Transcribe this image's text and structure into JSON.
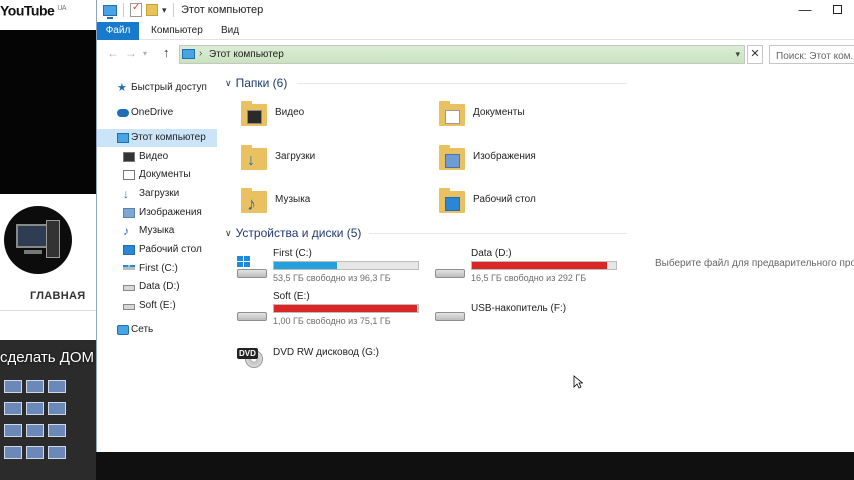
{
  "youtube": {
    "logo": "YouTube",
    "region": "UA",
    "nav_label": "ГЛАВНАЯ",
    "video_title": "сделать ДОМ"
  },
  "window": {
    "title": "Этот компьютер",
    "minimize": "—"
  },
  "ribbon": {
    "tabs": [
      "Файл",
      "Компьютер",
      "Вид"
    ],
    "active_tab": "Файл",
    "accent": "#1979ca"
  },
  "address": {
    "path": "Этот компьютер",
    "search_placeholder": "Поиск: Этот ком..."
  },
  "nav_pane": [
    {
      "label": "Быстрый доступ",
      "icon": "star-icon"
    },
    {
      "label": "OneDrive",
      "icon": "cloud-icon"
    },
    {
      "label": "Этот компьютер",
      "icon": "computer-icon",
      "selected": true
    },
    {
      "label": "Видео",
      "icon": "video-folder-icon"
    },
    {
      "label": "Документы",
      "icon": "documents-folder-icon"
    },
    {
      "label": "Загрузки",
      "icon": "downloads-folder-icon"
    },
    {
      "label": "Изображения",
      "icon": "pictures-folder-icon"
    },
    {
      "label": "Музыка",
      "icon": "music-folder-icon"
    },
    {
      "label": "Рабочий стол",
      "icon": "desktop-folder-icon"
    },
    {
      "label": "First (C:)",
      "icon": "windows-drive-icon"
    },
    {
      "label": "Data (D:)",
      "icon": "drive-icon"
    },
    {
      "label": "Soft (E:)",
      "icon": "drive-icon"
    },
    {
      "label": "Сеть",
      "icon": "network-icon"
    }
  ],
  "folders_group": {
    "title": "Папки (6)",
    "items": [
      {
        "name": "Видео",
        "icon": "video-folder-icon"
      },
      {
        "name": "Документы",
        "icon": "documents-folder-icon"
      },
      {
        "name": "Загрузки",
        "icon": "downloads-folder-icon"
      },
      {
        "name": "Изображения",
        "icon": "pictures-folder-icon"
      },
      {
        "name": "Музыка",
        "icon": "music-folder-icon"
      },
      {
        "name": "Рабочий стол",
        "icon": "desktop-folder-icon"
      }
    ]
  },
  "drives_group": {
    "title": "Устройства и диски (5)",
    "items": [
      {
        "name": "First (C:)",
        "free": "53,5 ГБ свободно из 96,3 ГБ",
        "used_fraction": 0.44,
        "bar_color": "#26a0da",
        "icon": "windows-drive-icon"
      },
      {
        "name": "Data (D:)",
        "free": "16,5 ГБ свободно из 292 ГБ",
        "used_fraction": 0.94,
        "bar_color": "#da2626",
        "icon": "drive-icon"
      },
      {
        "name": "Soft (E:)",
        "free": "1,00 ГБ свободно из 75,1 ГБ",
        "used_fraction": 0.99,
        "bar_color": "#da2626",
        "icon": "drive-icon"
      },
      {
        "name": "USB-накопитель (F:)",
        "icon": "usb-drive-icon"
      },
      {
        "name": "DVD RW дисковод (G:)",
        "icon": "dvd-drive-icon"
      }
    ]
  },
  "preview_message": "Выберите файл для предварительного просмо"
}
